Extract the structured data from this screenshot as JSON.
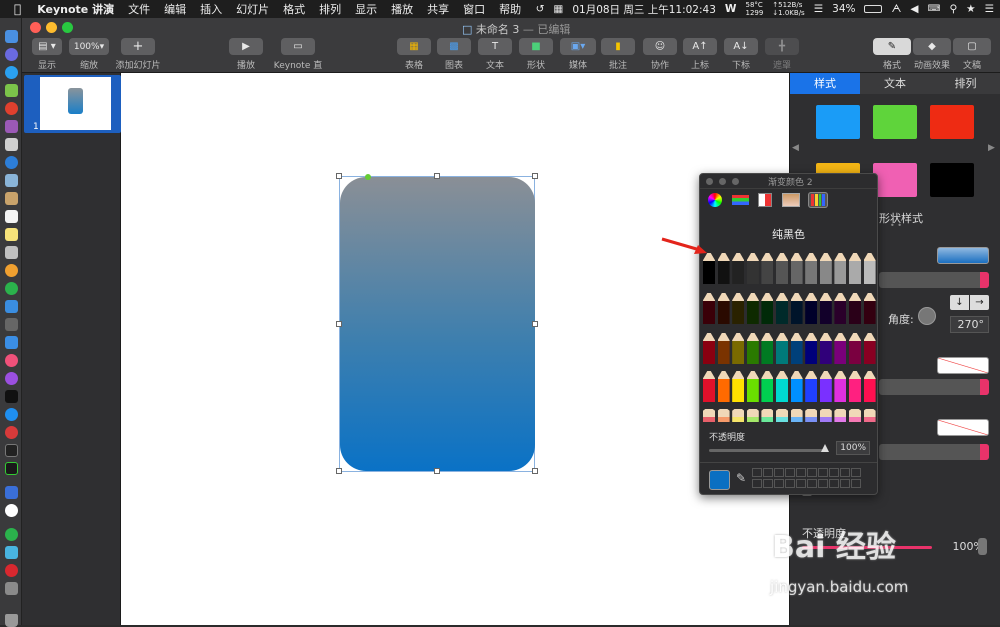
{
  "menubar": {
    "app_name": "Keynote 讲演",
    "items": [
      "文件",
      "编辑",
      "插入",
      "幻灯片",
      "格式",
      "排列",
      "显示",
      "播放",
      "共享",
      "窗口",
      "帮助"
    ],
    "temperature": "58°C",
    "fan_speed": "1299",
    "net_up": "↑512B/s",
    "net_down": "↓1.0KB/s",
    "date": "01月08日 周三 上午11:02:43",
    "battery": "34%"
  },
  "window": {
    "title": "未命名 3",
    "status": "— 已编辑"
  },
  "toolbar": {
    "display_label": "显示",
    "zoom_value": "100%",
    "zoom_label": "缩放",
    "add_slide_label": "添加幻灯片",
    "play_label": "播放",
    "keynote_live_label": "Keynote 直播",
    "table_label": "表格",
    "chart_label": "图表",
    "text_label": "文本",
    "shape_label": "形状",
    "media_label": "媒体",
    "comment_label": "批注",
    "collab_label": "协作",
    "superscript_label": "上标",
    "subscript_label": "下标",
    "mask_label": "遮罩",
    "format_label": "格式",
    "animate_label": "动画效果",
    "document_label": "文稿"
  },
  "navigator": {
    "slide_number": "1"
  },
  "inspector": {
    "tabs": [
      "样式",
      "文本",
      "排列"
    ],
    "style_swatches": [
      "#1a9cf7",
      "#5fd43b",
      "#ee2b13",
      "#f3b515",
      "#f060b3",
      "#000000"
    ],
    "shape_style_label": "形状样式",
    "angle_label": "角度:",
    "angle_value": "270°",
    "opacity_label": "不透明度",
    "opacity_value": "100%"
  },
  "color_popup": {
    "title": "渐变颜色 2",
    "color_name": "纯黑色",
    "opacity_label": "不透明度",
    "opacity_value": "100%",
    "current_color": "#0a6fc2"
  },
  "watermark": {
    "text": "Bai 经验",
    "url": "jingyan.baidu.com"
  }
}
